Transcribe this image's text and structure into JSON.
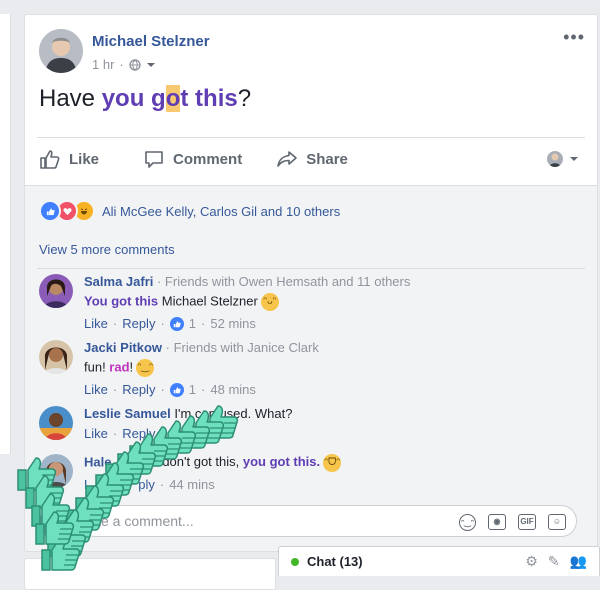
{
  "post": {
    "author": "Michael Stelzner",
    "time": "1 hr",
    "text_before": "Have ",
    "text_hl1": "you g",
    "text_sel": "o",
    "text_hl2": "t this",
    "text_after": "?",
    "actions": {
      "like": "Like",
      "comment": "Comment",
      "share": "Share"
    }
  },
  "reactions": {
    "names": "Ali McGee Kelly, Carlos Gil and 10 others"
  },
  "view_more": "View 5 more comments",
  "comments": [
    {
      "name": "Salma Jafri",
      "friends": " · Friends with Owen Hemsath and 11 others",
      "text_purple": "You got this",
      "text_plain": " Michael Stelzner",
      "like": "Like",
      "reply": "Reply",
      "likes": "1",
      "time": "52 mins"
    },
    {
      "name": "Jacki Pitkow",
      "friends": " · Friends with Janice Clark",
      "text_plain": "fun! ",
      "text_pink": "rad",
      "text_end": "!",
      "like": "Like",
      "reply": "Reply",
      "likes": "1",
      "time": "48 mins"
    },
    {
      "name": "Leslie Samuel",
      "text_partial": "I'm confused. What?",
      "like": "Like",
      "reply": "Reply",
      "time": "ns"
    },
    {
      "name": "Hale",
      "text_plain": "I don't got this, ",
      "text_purple": "you got this.",
      "like": "L",
      "reply": "ply",
      "time": "44 mins"
    }
  ],
  "write_placeholder": "ite a comment...",
  "chat": {
    "label": "Chat (13)"
  },
  "colors": {
    "link": "#365899",
    "highlight_purple": "#5f3eb3",
    "selection": "#f7c970",
    "thumb_green": "#5fd3b3",
    "online": "#42b72a"
  }
}
